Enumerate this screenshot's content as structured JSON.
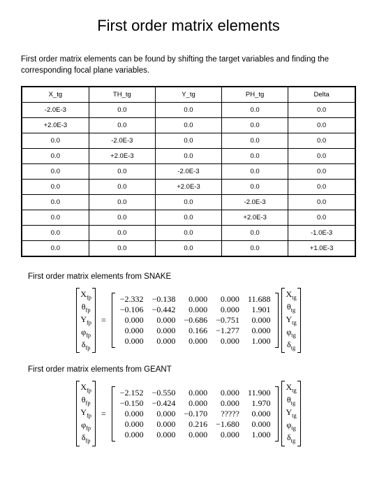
{
  "title": "First order matrix elements",
  "intro": "First order matrix elements can be found by shifting the target variables and finding the corresponding focal plane variables.",
  "table": {
    "headers": [
      "X_tg",
      "TH_tg",
      "Y_tg",
      "PH_tg",
      "Delta"
    ],
    "rows": [
      [
        "-2.0E-3",
        "0.0",
        "0.0",
        "0.0",
        "0.0"
      ],
      [
        "+2.0E-3",
        "0.0",
        "0.0",
        "0.0",
        "0.0"
      ],
      [
        "0.0",
        "-2.0E-3",
        "0.0",
        "0.0",
        "0.0"
      ],
      [
        "0.0",
        "+2.0E-3",
        "0.0",
        "0.0",
        "0.0"
      ],
      [
        "0.0",
        "0.0",
        "-2.0E-3",
        "0.0",
        "0.0"
      ],
      [
        "0.0",
        "0.0",
        "+2.0E-3",
        "0.0",
        "0.0"
      ],
      [
        "0.0",
        "0.0",
        "0.0",
        "-2.0E-3",
        "0.0"
      ],
      [
        "0.0",
        "0.0",
        "0.0",
        "+2.0E-3",
        "0.0"
      ],
      [
        "0.0",
        "0.0",
        "0.0",
        "0.0",
        "-1.0E-3"
      ],
      [
        "0.0",
        "0.0",
        "0.0",
        "0.0",
        "+1.0E-3"
      ]
    ]
  },
  "snake": {
    "label": "First order matrix elements from SNAKE",
    "matrix": [
      [
        "−2.332",
        "−0.138",
        "0.000",
        "0.000",
        "11.688"
      ],
      [
        "−0.106",
        "−0.442",
        "0.000",
        "0.000",
        "1.901"
      ],
      [
        "0.000",
        "0.000",
        "−0.686",
        "−0.751",
        "0.000"
      ],
      [
        "0.000",
        "0.000",
        "0.166",
        "−1.277",
        "0.000"
      ],
      [
        "0.000",
        "0.000",
        "0.000",
        "0.000",
        "1.000"
      ]
    ]
  },
  "geant": {
    "label": "First order matrix elements from GEANT",
    "matrix": [
      [
        "−2.152",
        "−0.550",
        "0.000",
        "0.000",
        "11.900"
      ],
      [
        "−0.150",
        "−0.424",
        "0.000",
        "0.000",
        "1.970"
      ],
      [
        "0.000",
        "0.000",
        "−0.170",
        "?????",
        "0.000"
      ],
      [
        "0.000",
        "0.000",
        "0.216",
        "−1.680",
        "0.000"
      ],
      [
        "0.000",
        "0.000",
        "0.000",
        "0.000",
        "1.000"
      ]
    ]
  },
  "vec_fp": [
    "X_fp",
    "θ_fp",
    "Y_fp",
    "φ_fp",
    "δ_fp"
  ],
  "vec_tg": [
    "X_tg",
    "θ_tg",
    "Y_tg",
    "φ_tg",
    "δ_tg"
  ],
  "eq": "="
}
